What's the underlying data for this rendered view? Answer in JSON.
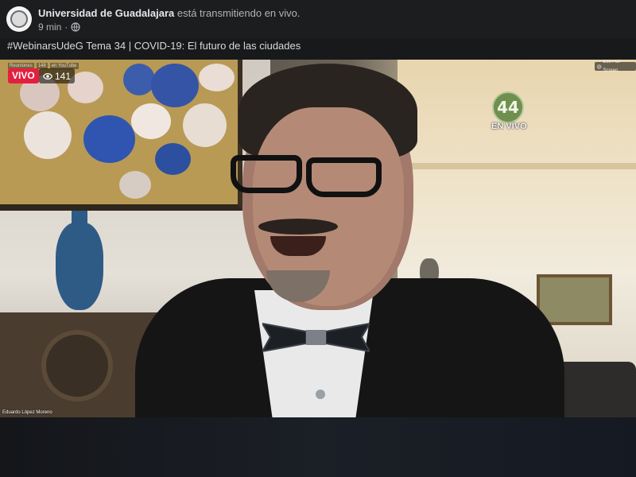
{
  "post": {
    "page_name": "Universidad de Guadalajara",
    "action_text": "está transmitiendo en vivo.",
    "time": "9 min",
    "separator": "·",
    "audience_icon": "globe-icon",
    "text": "#WebinarsUdeG Tema 34 | COVID-19: El futuro de las ciudades"
  },
  "video": {
    "live_label": "VIVO",
    "viewers_icon": "eye-icon",
    "viewer_count": "141",
    "exit_fullscreen_label": "Exit Full Screen",
    "channel_logo_text": "44",
    "channel_live_text": "EN VIVO",
    "participant_name": "Eduardo López Moreno",
    "tiny_tabs": [
      "Reuniones",
      "148",
      "en YouTube"
    ]
  },
  "colors": {
    "live_red": "#e41e3f",
    "background": "#18191a"
  }
}
